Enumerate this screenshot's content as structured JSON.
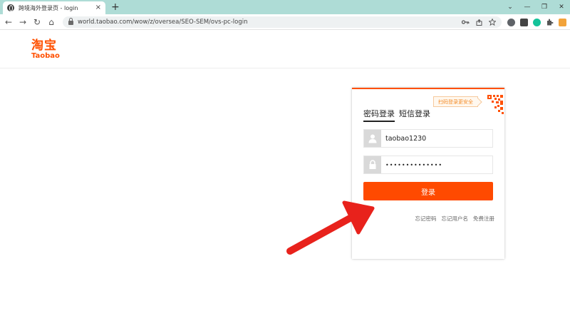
{
  "browser": {
    "tab_title": "跨境海外登录页 - login",
    "tab_close": "×",
    "new_tab": "+",
    "window_controls": {
      "minimize": "⌄",
      "minimize2": "—",
      "restore": "❐",
      "close": "✕"
    },
    "url": "world.taobao.com/wow/z/oversea/SEO-SEM/ovs-pc-login",
    "nav": {
      "back": "←",
      "forward": "→",
      "reload": "↻",
      "home": "⌂"
    }
  },
  "header": {
    "logo_cn": "淘宝",
    "logo_en": "Taobao"
  },
  "login": {
    "qr_tip": "扫码登录更安全",
    "tabs": [
      {
        "label": "密码登录",
        "active": true
      },
      {
        "label": "短信登录",
        "active": false
      }
    ],
    "username_value": "taobao1230",
    "password_value": "••••••••••••••",
    "submit_label": "登录",
    "links": [
      {
        "label": "忘记密码"
      },
      {
        "label": "忘记用户名"
      },
      {
        "label": "免费注册"
      }
    ]
  },
  "colors": {
    "brand": "#ff5000",
    "button": "#ff4a00",
    "arrow": "#e8221c",
    "tabbar": "#aedcd6"
  },
  "icons": [
    "globe-icon",
    "lock-icon",
    "key-icon",
    "share-icon",
    "star-icon",
    "user-icon",
    "padlock-icon",
    "qr-code-icon",
    "red-arrow-icon"
  ]
}
